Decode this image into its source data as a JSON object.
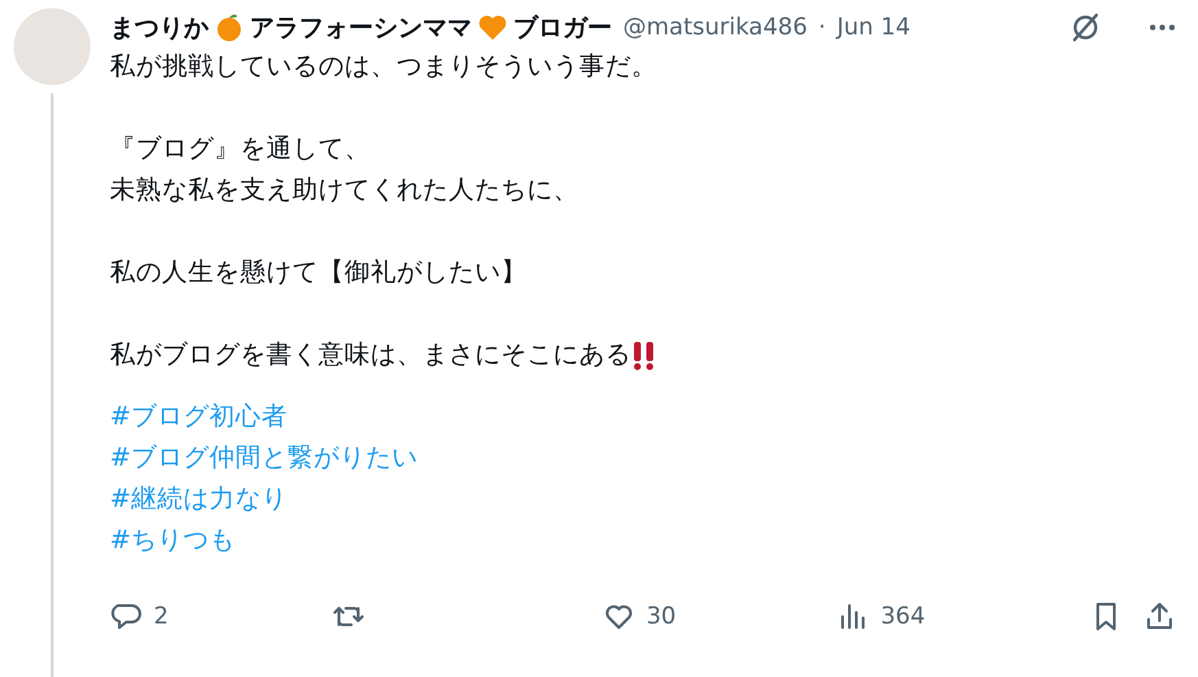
{
  "author": {
    "name_parts": [
      "まつりか",
      "アラフォーシンママ",
      "ブロガー"
    ],
    "handle": "@matsurika486",
    "separator": "·",
    "date": "Jun 14"
  },
  "body": [
    [
      "私が挑戦しているのは、つまりそういう事だ。"
    ],
    [
      "『ブログ』を通して、",
      "未熟な私を支え助けてくれた人たちに、"
    ],
    [
      "私の人生を懸けて【御礼がしたい】"
    ],
    [
      "私がブログを書く意味は、まさにそこにある"
    ]
  ],
  "hashtags": [
    "#ブログ初心者",
    "#ブログ仲間と繋がりたい",
    "#継続は力なり",
    "#ちりつも"
  ],
  "actions": [
    {
      "kind": "reply",
      "count": "2"
    },
    {
      "kind": "repost"
    },
    {
      "kind": "like",
      "count": "30"
    },
    {
      "kind": "views",
      "count": "364"
    },
    {
      "kind": "bookmark"
    },
    {
      "kind": "share"
    }
  ]
}
